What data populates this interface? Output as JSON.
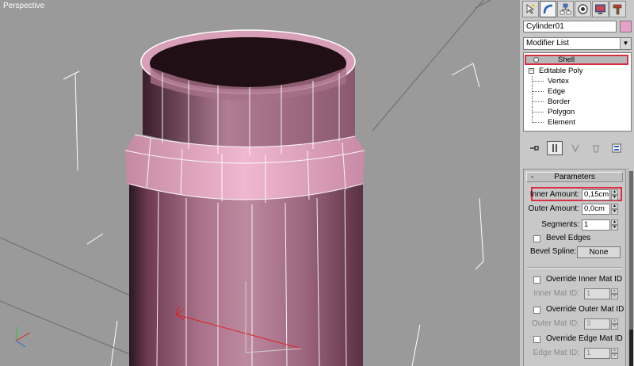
{
  "viewport": {
    "label": "Perspective"
  },
  "command_panel": {
    "tabs": [
      {
        "name": "create-tab",
        "icon": "pointer-star-icon"
      },
      {
        "name": "modify-tab",
        "icon": "bend-arc-icon",
        "active": true
      },
      {
        "name": "hierarchy-tab",
        "icon": "hierarchy-icon"
      },
      {
        "name": "motion-tab",
        "icon": "motion-circle-icon"
      },
      {
        "name": "display-tab",
        "icon": "monitor-icon"
      },
      {
        "name": "utilities-tab",
        "icon": "hammer-icon"
      }
    ],
    "object_name": "Cylinder01",
    "object_color": "#e8a0c8",
    "modifier_list": "Modifier List",
    "stack": {
      "shell": "Shell",
      "editable_poly": "Editable Poly",
      "toggle": "⊟",
      "subobjects": [
        "Vertex",
        "Edge",
        "Border",
        "Polygon",
        "Element"
      ]
    },
    "parameters": {
      "header": "Parameters",
      "header_sign": "-",
      "inner_amount_label": "Inner Amount:",
      "inner_amount": "0,15cm",
      "outer_amount_label": "Outer Amount:",
      "outer_amount": "0,0cm",
      "segments_label": "Segments:",
      "segments": "1",
      "bevel_edges": "Bevel Edges",
      "bevel_spline_label": "Bevel Spline:",
      "bevel_spline_value": "None",
      "override_inner": "Override Inner Mat ID",
      "inner_mat_id_label": "Inner Mat ID:",
      "inner_mat_id": "1",
      "override_outer": "Override Outer Mat ID",
      "outer_mat_id_label": "Outer Mat ID:",
      "outer_mat_id": "3",
      "override_edge": "Override Edge Mat ID",
      "edge_mat_id_label": "Edge Mat ID:",
      "edge_mat_id": "1"
    },
    "colors": {
      "highlight": "#d83040",
      "mesh": "#c9889c"
    }
  }
}
